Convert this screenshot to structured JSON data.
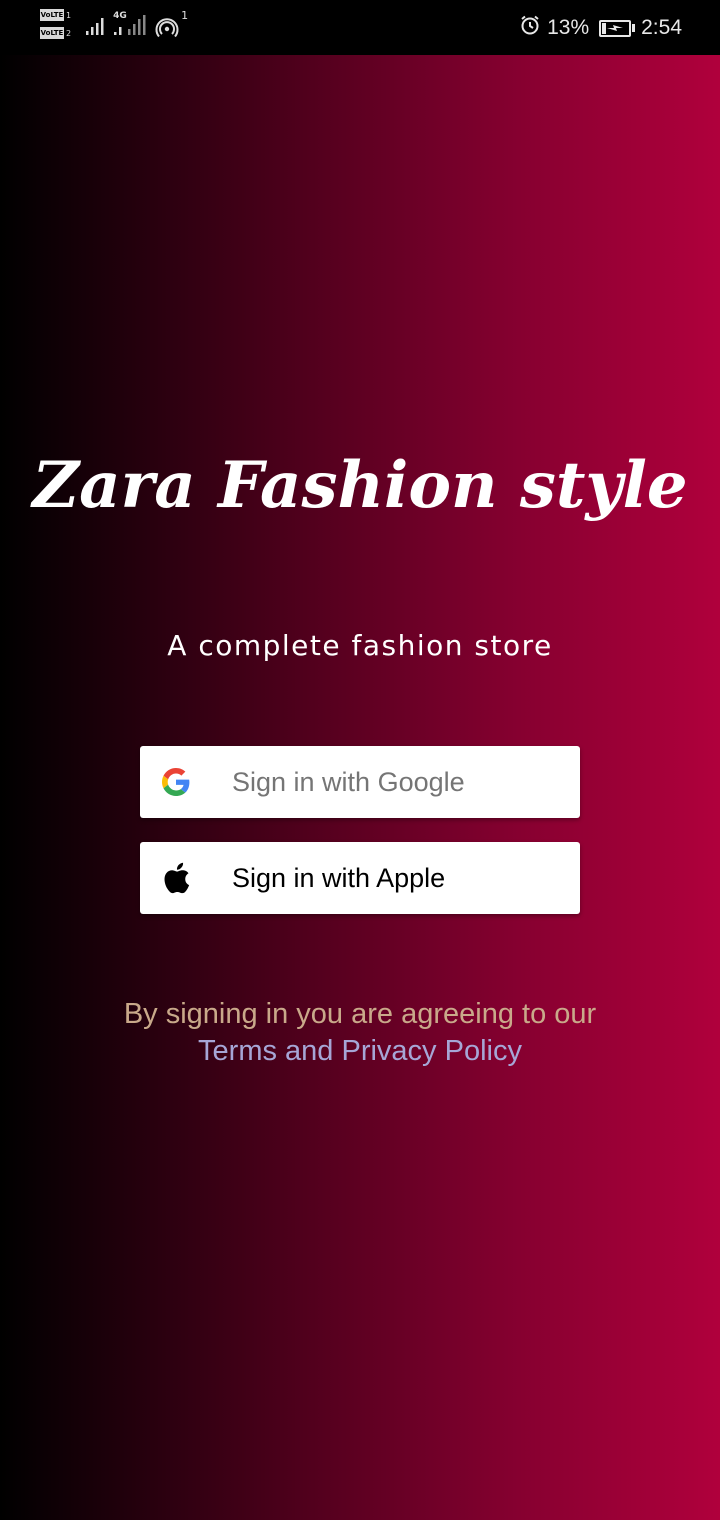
{
  "status_bar": {
    "volte_label": "VoLTE",
    "sim1": "1",
    "sim2": "2",
    "network_type": "4G",
    "hotspot_count": "1",
    "battery_percent": "13%",
    "time": "2:54"
  },
  "brand": {
    "title": "Zara Fashion style",
    "tagline": "A complete fashion store"
  },
  "auth": {
    "google_label": "Sign in with Google",
    "apple_label": "Sign in with Apple"
  },
  "legal": {
    "text": "By signing in you are agreeing to our",
    "link": "Terms and Privacy Policy"
  },
  "colors": {
    "gradient_start": "#000000",
    "gradient_end": "#b0003c",
    "legal_text": "#c9a98a",
    "legal_link": "#a6a6d6",
    "google_label": "#757575"
  },
  "icons": {
    "google": "google-logo-icon",
    "apple": "apple-logo-icon",
    "alarm": "alarm-icon",
    "battery": "battery-charging-icon",
    "signal": "signal-bars-icon",
    "hotspot": "hotspot-icon"
  }
}
